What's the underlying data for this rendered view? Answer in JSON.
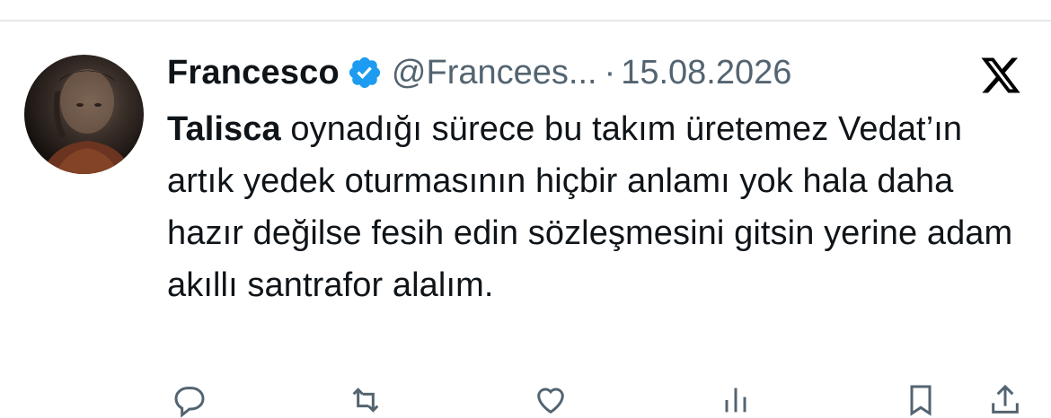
{
  "tweet": {
    "author_name": "Francesco",
    "handle": "@Francees...",
    "separator": "·",
    "date": "15.08.2026",
    "mention": "Talisca",
    "body": " oynadığı sürece bu takım üretemez Vedat’ın artık yedek oturmasının hiçbir anlamı yok hala daha hazır değilse fesih edin sözleşmesini gitsin yerine adam akıllı santrafor alalım."
  },
  "icons": {
    "verified": "verified-badge-icon",
    "brand": "x-logo-icon",
    "actions": [
      "reply-icon",
      "retweet-icon",
      "like-icon",
      "views-icon",
      "bookmark-icon",
      "share-icon"
    ]
  },
  "colors": {
    "verified_blue": "#1d9bf0",
    "text": "#0f1419",
    "secondary_text": "#536471",
    "divider": "#e6e9eb"
  }
}
